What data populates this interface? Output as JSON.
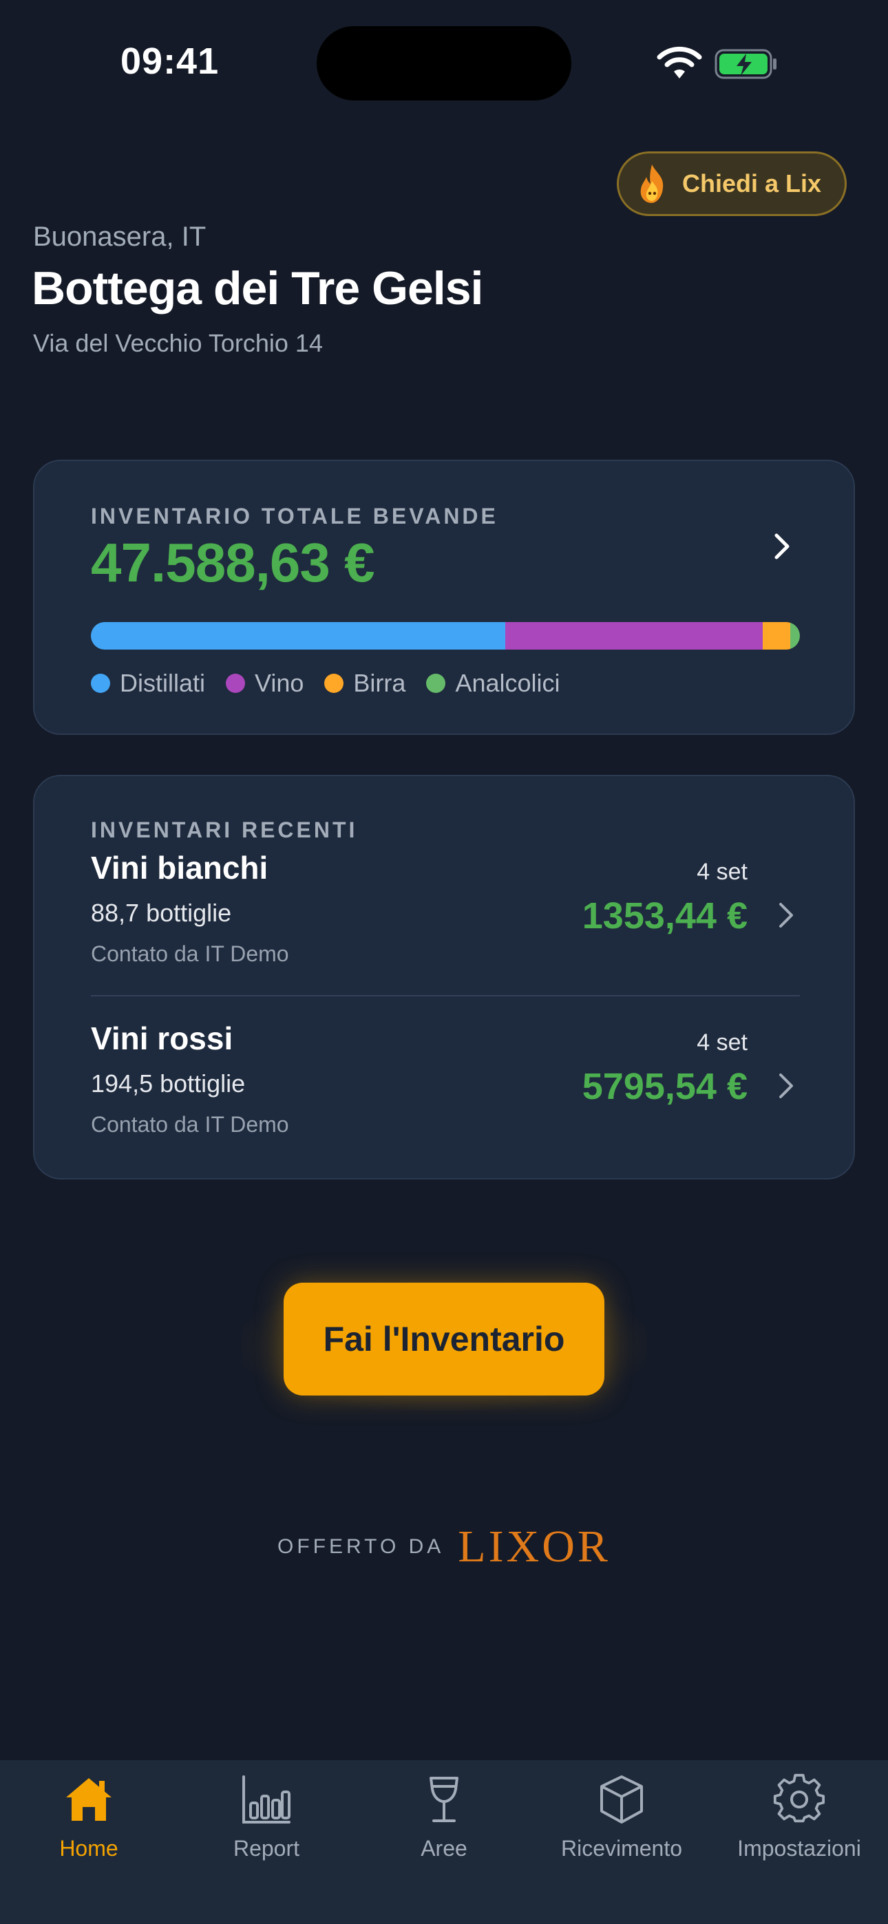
{
  "status_bar": {
    "time": "09:41"
  },
  "ask_button": {
    "label": "Chiedi a Lix"
  },
  "header": {
    "greeting": "Buonasera, IT",
    "venue_name": "Bottega dei Tre Gelsi",
    "address": "Via del Vecchio Torchio 14"
  },
  "total_inventory": {
    "label": "INVENTARIO TOTALE BEVANDE",
    "value": "47.588,63 €",
    "breakdown": [
      {
        "name": "Distillati",
        "share": 0.584,
        "color": "#42a5f5"
      },
      {
        "name": "Vino",
        "share": 0.364,
        "color": "#ab47bc"
      },
      {
        "name": "Birra",
        "share": 0.038,
        "color": "#ffa726"
      },
      {
        "name": "Analcolici",
        "share": 0.014,
        "color": "#66bb6a"
      }
    ]
  },
  "recent": {
    "label": "INVENTARI RECENTI",
    "items": [
      {
        "name": "Vini bianchi",
        "count": "88,7 bottiglie",
        "by": "Contato da IT Demo",
        "date": "4 set",
        "value": "1353,44 €"
      },
      {
        "name": "Vini rossi",
        "count": "194,5 bottiglie",
        "by": "Contato da IT Demo",
        "date": "4 set",
        "value": "5795,54 €"
      }
    ]
  },
  "cta": {
    "label": "Fai l'Inventario"
  },
  "footer": {
    "offered_by": "OFFERTO DA",
    "brand": "LIXOR"
  },
  "tabs": [
    {
      "label": "Home",
      "icon": "home-icon",
      "active": true
    },
    {
      "label": "Report",
      "icon": "bar-chart-icon",
      "active": false
    },
    {
      "label": "Aree",
      "icon": "wine-glass-icon",
      "active": false
    },
    {
      "label": "Ricevimento",
      "icon": "box-icon",
      "active": false
    },
    {
      "label": "Impostazioni",
      "icon": "gear-icon",
      "active": false
    }
  ],
  "colors": {
    "accent": "#f5a300",
    "positive": "#4caf50",
    "background": "#141a27",
    "card": "#1e2a3d"
  }
}
